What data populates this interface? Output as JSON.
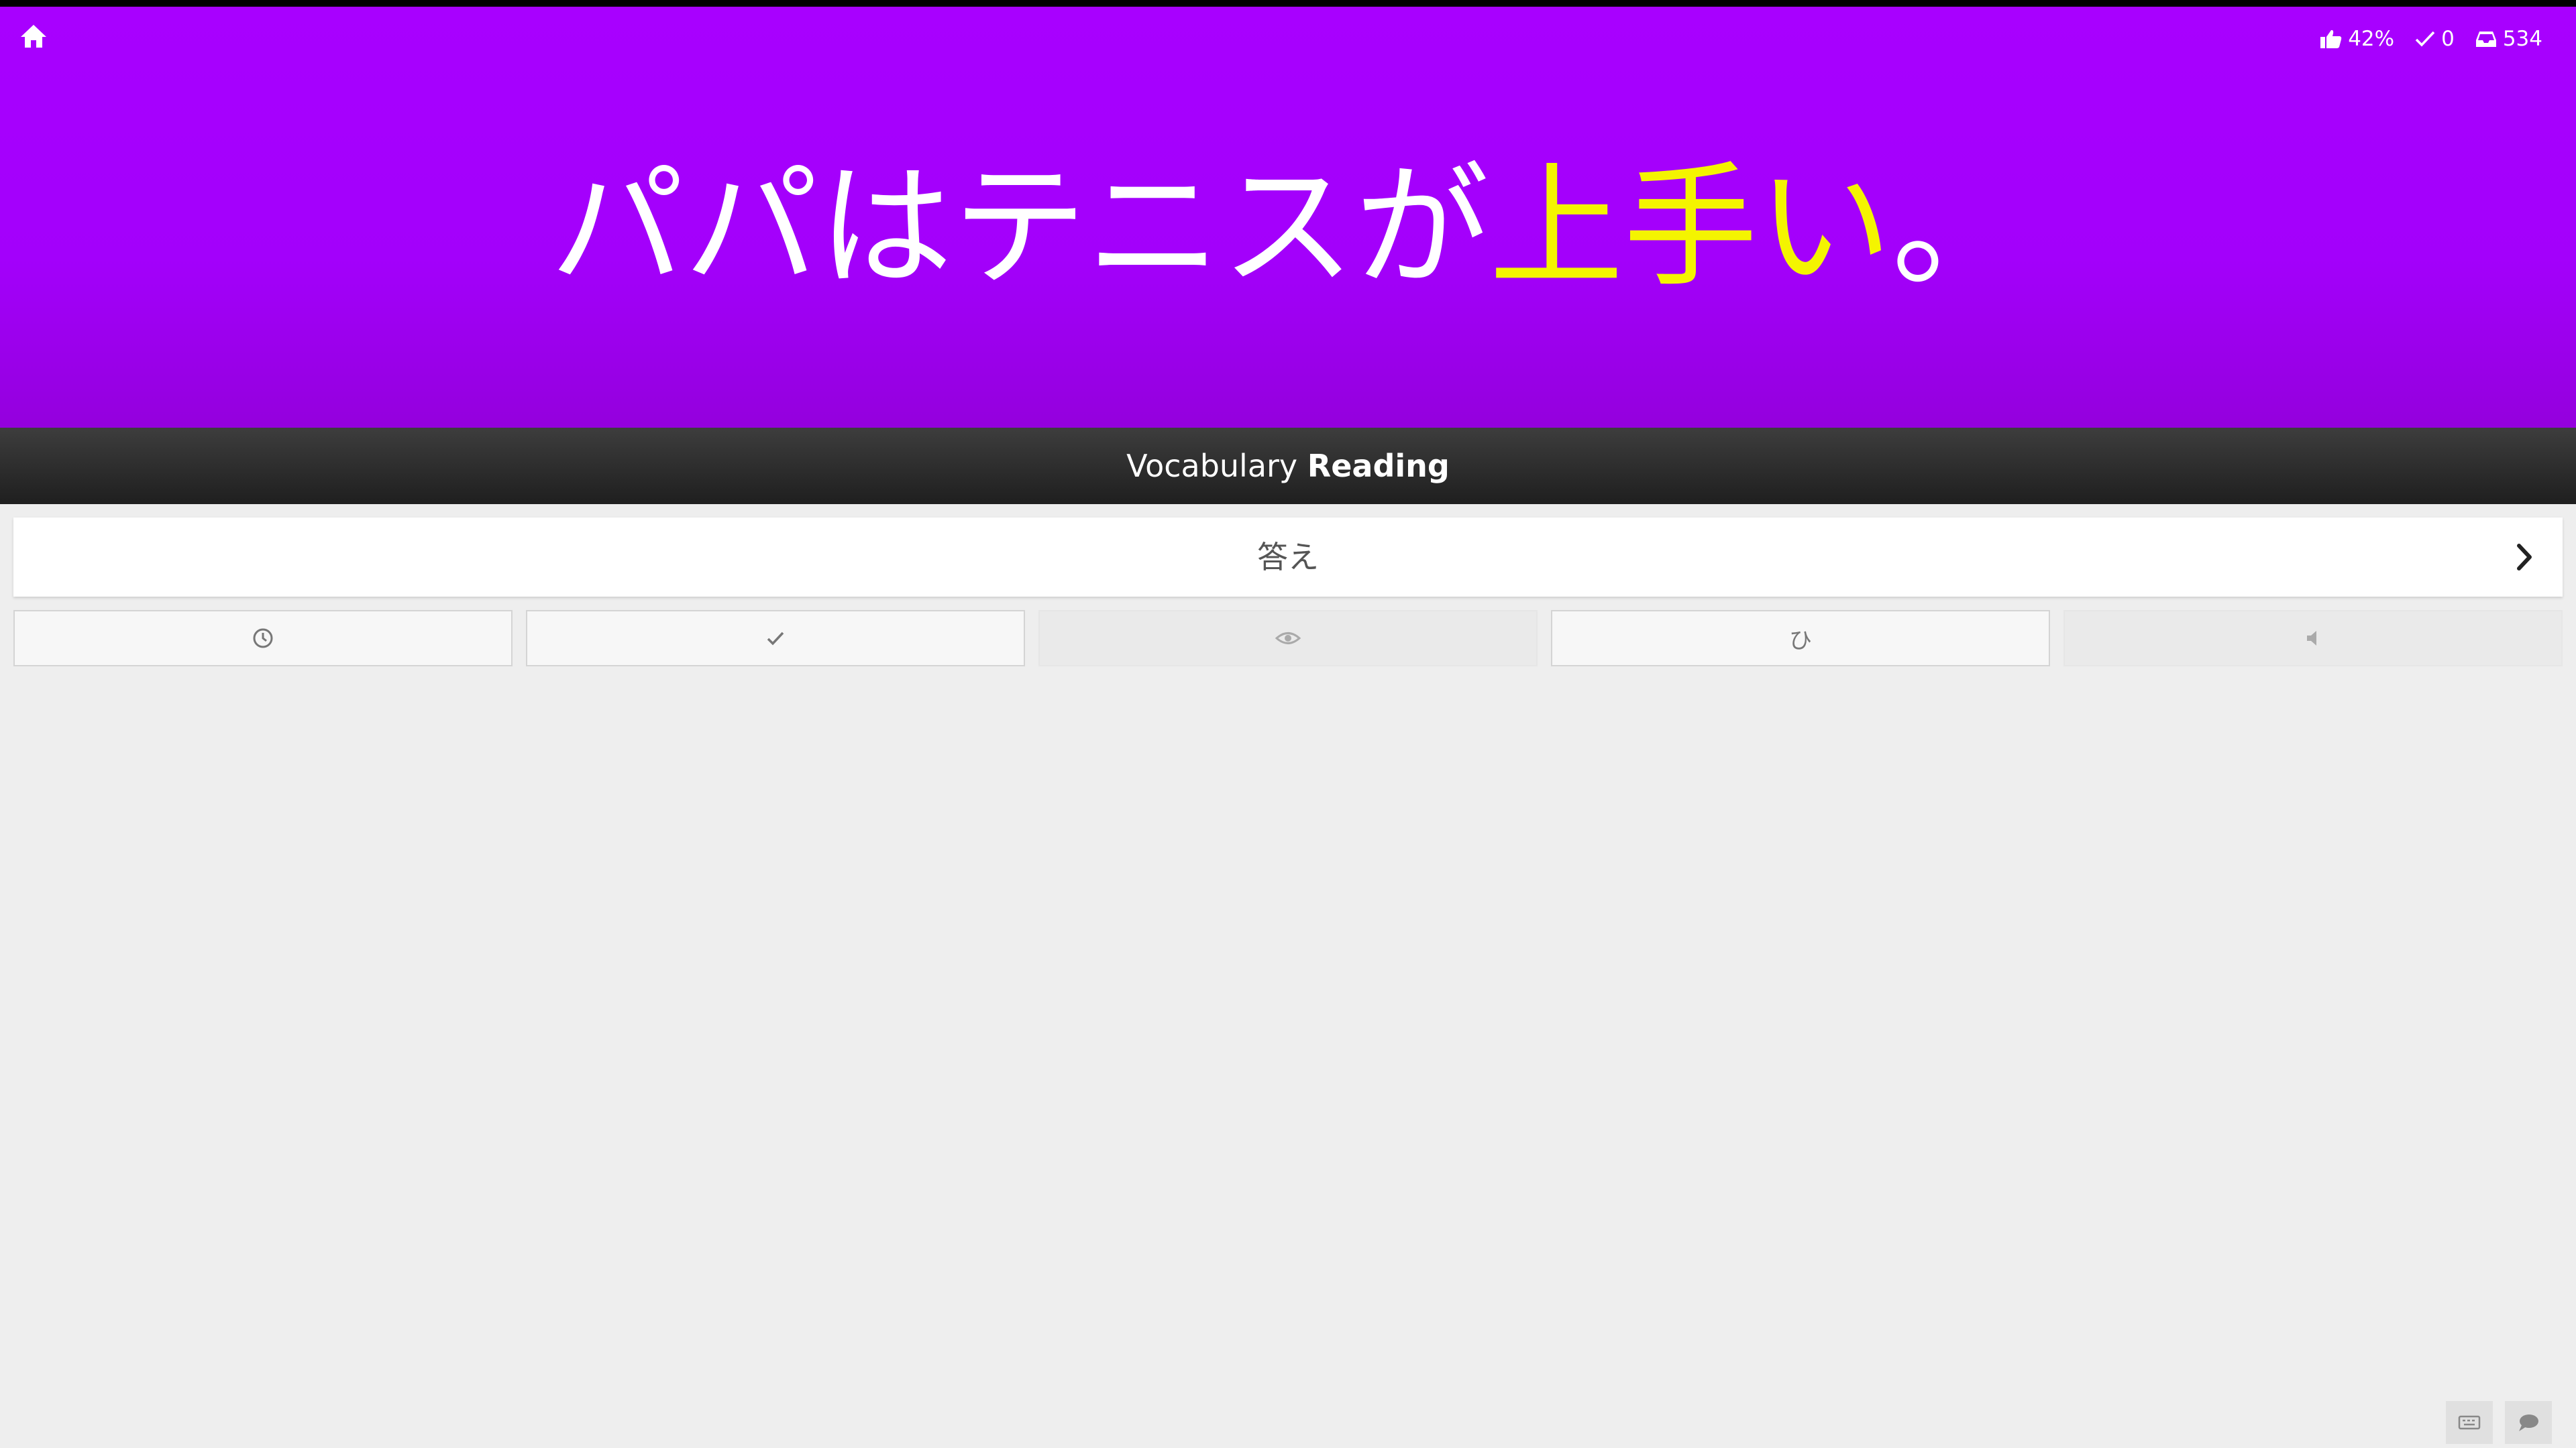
{
  "header": {
    "stats": {
      "correct_rate": "42%",
      "completed": "0",
      "queue": "534"
    }
  },
  "sentence": {
    "before": "パパはテニスが",
    "highlight": "上手い",
    "after": "。"
  },
  "question_type": {
    "category": "Vocabulary",
    "type": "Reading"
  },
  "answer_field": {
    "placeholder": "答え",
    "value": ""
  },
  "action_buttons": [
    {
      "icon": "clock-icon"
    },
    {
      "icon": "checkmark-icon"
    },
    {
      "icon": "eye-icon"
    },
    {
      "icon": "hiragana-icon",
      "label": "ひ"
    },
    {
      "icon": "speaker-icon"
    }
  ],
  "footer": {
    "icons": [
      "keyboard-icon",
      "chat-bubble-icon"
    ]
  },
  "colors": {
    "banner": "#a800ff",
    "highlight": "#f4f400",
    "bar": "#2b2b2b",
    "background": "#eeeeee"
  }
}
